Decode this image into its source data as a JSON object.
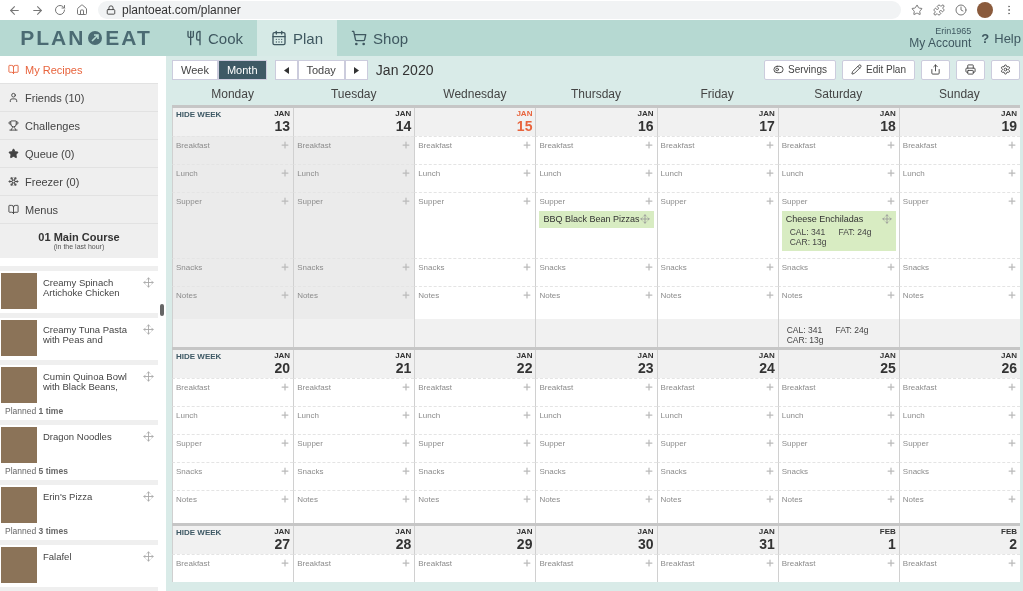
{
  "browser": {
    "url": "plantoeat.com/planner"
  },
  "nav": {
    "logo": {
      "left": "PLAN",
      "right": "EAT"
    },
    "tabs": [
      {
        "label": "Cook",
        "selected": false
      },
      {
        "label": "Plan",
        "selected": true
      },
      {
        "label": "Shop",
        "selected": false
      }
    ],
    "account": {
      "username": "Erin1965",
      "label": "My Account"
    },
    "help": {
      "icon": "?",
      "label": "Help"
    }
  },
  "sidebar": {
    "items": [
      {
        "label": "My Recipes",
        "selected": true
      },
      {
        "label": "Friends (10)",
        "selected": false
      },
      {
        "label": "Challenges",
        "selected": false
      },
      {
        "label": "Queue (0)",
        "selected": false
      },
      {
        "label": "Freezer (0)",
        "selected": false
      },
      {
        "label": "Menus",
        "selected": false
      }
    ],
    "section": {
      "title": "01 Main Course",
      "subtitle": "(in the last hour)"
    },
    "recipes": [
      {
        "name": "Creamy Spinach Artichoke Chicken"
      },
      {
        "name": "Creamy Tuna Pasta with Peas and"
      },
      {
        "name": "Cumin Quinoa Bowl with Black Beans,",
        "planned": "Planned **1 time**"
      },
      {
        "name": "Dragon Noodles",
        "planned": "Planned **5 times**"
      },
      {
        "name": "Erin's Pizza",
        "planned": "Planned **3 times**"
      },
      {
        "name": "Falafel"
      }
    ]
  },
  "toolbar": {
    "views": [
      {
        "label": "Week",
        "selected": false
      },
      {
        "label": "Month",
        "selected": true
      }
    ],
    "today": "Today",
    "period": "Jan 2020",
    "actions": [
      {
        "label": "Servings"
      },
      {
        "label": "Edit Plan"
      }
    ]
  },
  "weekdays": [
    "Monday",
    "Tuesday",
    "Wednesday",
    "Thursday",
    "Friday",
    "Saturday",
    "Sunday"
  ],
  "weeks": [
    {
      "hide": "HIDE WEEK",
      "days": [
        {
          "month": "JAN",
          "day": "13",
          "past": true,
          "today": false,
          "slots": [
            {
              "label": "Breakfast"
            },
            {
              "label": "Lunch"
            },
            {
              "label": "Supper"
            },
            {
              "label": "Snacks"
            },
            {
              "label": "Notes"
            }
          ]
        },
        {
          "month": "JAN",
          "day": "14",
          "past": true,
          "today": false,
          "slots": [
            {
              "label": "Breakfast"
            },
            {
              "label": "Lunch"
            },
            {
              "label": "Supper"
            },
            {
              "label": "Snacks"
            },
            {
              "label": "Notes"
            }
          ]
        },
        {
          "month": "JAN",
          "day": "15",
          "past": false,
          "today": true,
          "slots": [
            {
              "label": "Breakfast"
            },
            {
              "label": "Lunch"
            },
            {
              "label": "Supper"
            },
            {
              "label": "Snacks"
            },
            {
              "label": "Notes"
            }
          ]
        },
        {
          "month": "JAN",
          "day": "16",
          "past": false,
          "today": false,
          "slots": [
            {
              "label": "Breakfast"
            },
            {
              "label": "Lunch"
            },
            {
              "label": "Supper",
              "entries": [
                {
                  "name": "BBQ Black Bean Pizzas"
                }
              ]
            },
            {
              "label": "Snacks"
            },
            {
              "label": "Notes"
            }
          ]
        },
        {
          "month": "JAN",
          "day": "17",
          "past": false,
          "today": false,
          "slots": [
            {
              "label": "Breakfast"
            },
            {
              "label": "Lunch"
            },
            {
              "label": "Supper"
            },
            {
              "label": "Snacks"
            },
            {
              "label": "Notes"
            }
          ]
        },
        {
          "month": "JAN",
          "day": "18",
          "past": false,
          "today": false,
          "slots": [
            {
              "label": "Breakfast"
            },
            {
              "label": "Lunch"
            },
            {
              "label": "Supper",
              "entries": [
                {
                  "name": "Cheese Enchiladas",
                  "nutrition": [
                    "CAL: 341",
                    "FAT: 24g",
                    "CAR: 13g"
                  ]
                }
              ]
            },
            {
              "label": "Snacks"
            },
            {
              "label": "Notes"
            }
          ],
          "totals": [
            "CAL: 341",
            "FAT: 24g",
            "CAR: 13g"
          ]
        },
        {
          "month": "JAN",
          "day": "19",
          "past": false,
          "today": false,
          "slots": [
            {
              "label": "Breakfast"
            },
            {
              "label": "Lunch"
            },
            {
              "label": "Supper"
            },
            {
              "label": "Snacks"
            },
            {
              "label": "Notes"
            }
          ]
        }
      ]
    },
    {
      "hide": "HIDE WEEK",
      "days": [
        {
          "month": "JAN",
          "day": "20",
          "past": false,
          "today": false,
          "slots": [
            {
              "label": "Breakfast"
            },
            {
              "label": "Lunch"
            },
            {
              "label": "Supper"
            },
            {
              "label": "Snacks"
            },
            {
              "label": "Notes"
            }
          ]
        },
        {
          "month": "JAN",
          "day": "21",
          "past": false,
          "today": false,
          "slots": [
            {
              "label": "Breakfast"
            },
            {
              "label": "Lunch"
            },
            {
              "label": "Supper"
            },
            {
              "label": "Snacks"
            },
            {
              "label": "Notes"
            }
          ]
        },
        {
          "month": "JAN",
          "day": "22",
          "past": false,
          "today": false,
          "slots": [
            {
              "label": "Breakfast"
            },
            {
              "label": "Lunch"
            },
            {
              "label": "Supper"
            },
            {
              "label": "Snacks"
            },
            {
              "label": "Notes"
            }
          ]
        },
        {
          "month": "JAN",
          "day": "23",
          "past": false,
          "today": false,
          "slots": [
            {
              "label": "Breakfast"
            },
            {
              "label": "Lunch"
            },
            {
              "label": "Supper"
            },
            {
              "label": "Snacks"
            },
            {
              "label": "Notes"
            }
          ]
        },
        {
          "month": "JAN",
          "day": "24",
          "past": false,
          "today": false,
          "slots": [
            {
              "label": "Breakfast"
            },
            {
              "label": "Lunch"
            },
            {
              "label": "Supper"
            },
            {
              "label": "Snacks"
            },
            {
              "label": "Notes"
            }
          ]
        },
        {
          "month": "JAN",
          "day": "25",
          "past": false,
          "today": false,
          "slots": [
            {
              "label": "Breakfast"
            },
            {
              "label": "Lunch"
            },
            {
              "label": "Supper"
            },
            {
              "label": "Snacks"
            },
            {
              "label": "Notes"
            }
          ]
        },
        {
          "month": "JAN",
          "day": "26",
          "past": false,
          "today": false,
          "slots": [
            {
              "label": "Breakfast"
            },
            {
              "label": "Lunch"
            },
            {
              "label": "Supper"
            },
            {
              "label": "Snacks"
            },
            {
              "label": "Notes"
            }
          ]
        }
      ]
    },
    {
      "hide": "HIDE WEEK",
      "days": [
        {
          "month": "JAN",
          "day": "27",
          "past": false,
          "today": false,
          "slots": [
            {
              "label": "Breakfast"
            }
          ]
        },
        {
          "month": "JAN",
          "day": "28",
          "past": false,
          "today": false,
          "slots": [
            {
              "label": "Breakfast"
            }
          ]
        },
        {
          "month": "JAN",
          "day": "29",
          "past": false,
          "today": false,
          "slots": [
            {
              "label": "Breakfast"
            }
          ]
        },
        {
          "month": "JAN",
          "day": "30",
          "past": false,
          "today": false,
          "slots": [
            {
              "label": "Breakfast"
            }
          ]
        },
        {
          "month": "JAN",
          "day": "31",
          "past": false,
          "today": false,
          "slots": [
            {
              "label": "Breakfast"
            }
          ]
        },
        {
          "month": "FEB",
          "day": "1",
          "past": false,
          "today": false,
          "slots": [
            {
              "label": "Breakfast"
            }
          ]
        },
        {
          "month": "FEB",
          "day": "2",
          "past": false,
          "today": false,
          "slots": [
            {
              "label": "Breakfast"
            }
          ]
        }
      ]
    }
  ]
}
